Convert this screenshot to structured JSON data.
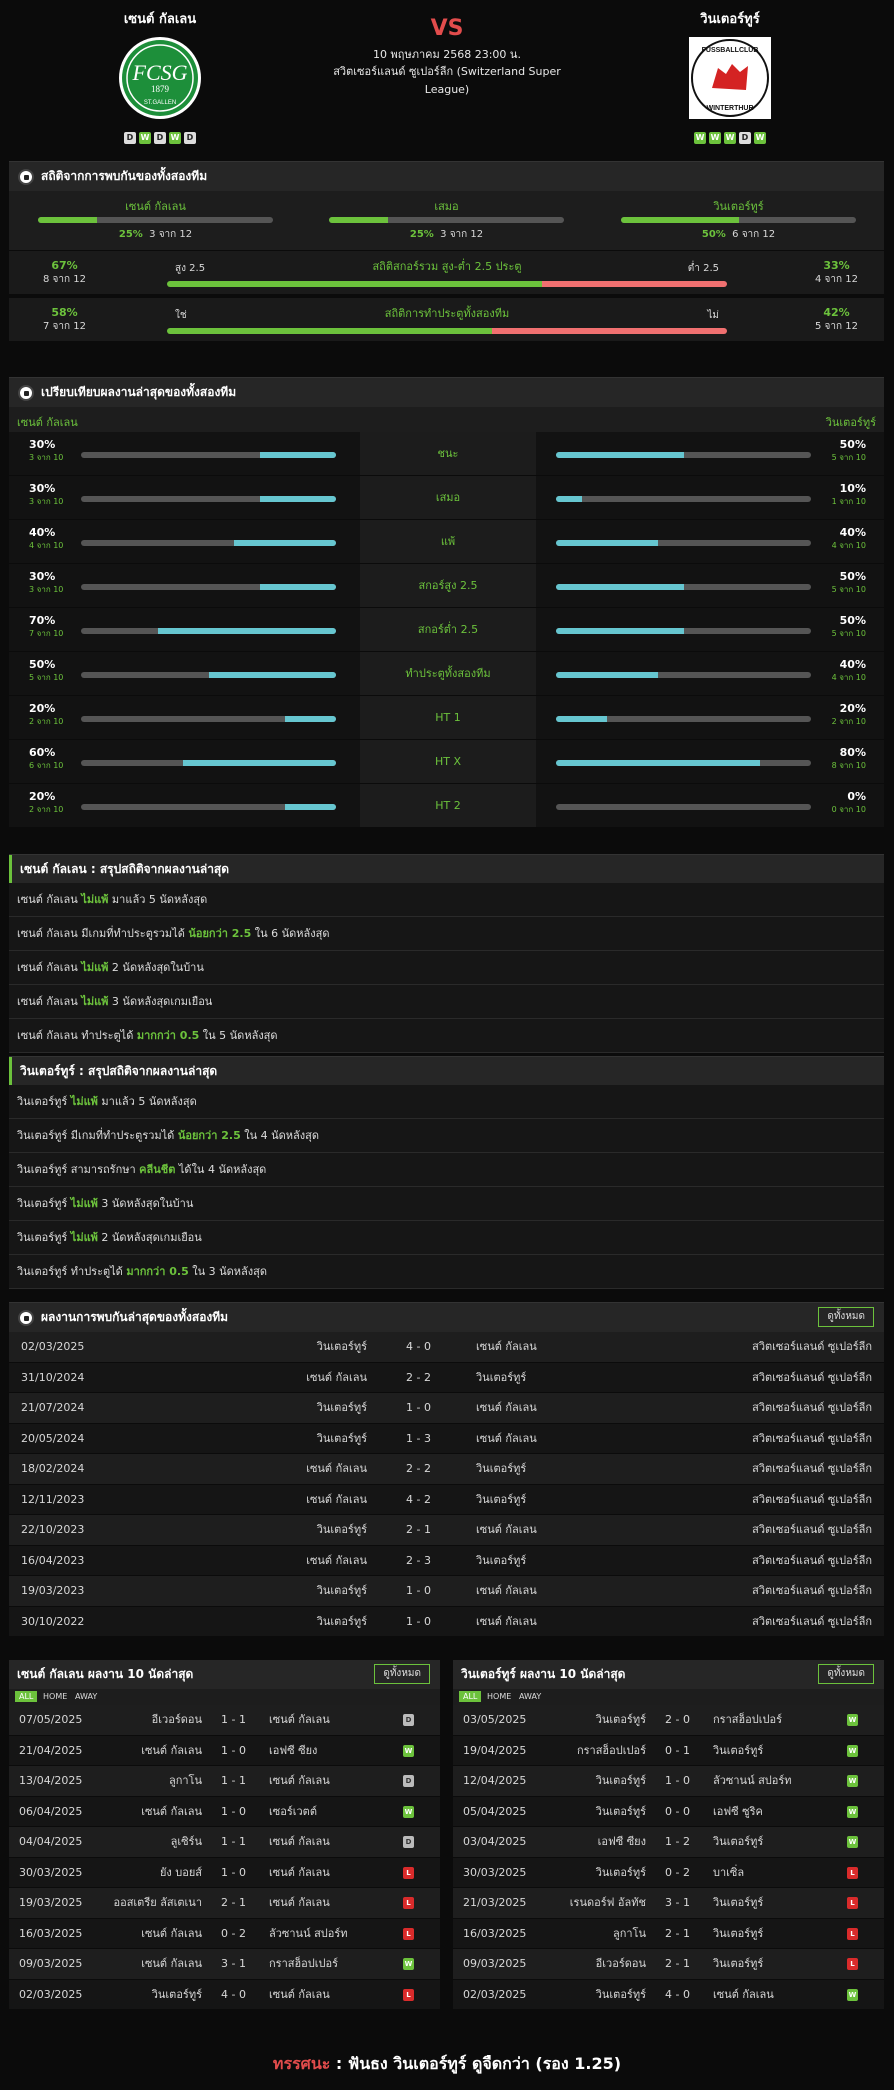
{
  "header": {
    "home_name": "เซนต์ กัลเลน",
    "away_name": "วินเตอร์ทูร์",
    "vs": "VS",
    "date": "10 พฤษภาคม 2568 23:00 น.",
    "league": "สวิตเซอร์แลนด์ ซูเปอร์ลีก (Switzerland Super League)",
    "home_form": [
      "D",
      "W",
      "D",
      "W",
      "D"
    ],
    "away_form": [
      "W",
      "W",
      "W",
      "D",
      "W"
    ],
    "home_logo_text": "FCSG",
    "home_logo_year": "1879",
    "home_logo_sub": "ST.GALLEN",
    "away_logo_top": "FUSSBALLCLUB",
    "away_logo_bottom": "WINTERTHUR"
  },
  "h2h_stats": {
    "title": "สถิติจากการพบกันของทั้งสองทีม",
    "cols": [
      {
        "label": "เซนต์ กัลเลน",
        "pct": "25%",
        "sub": "3 จาก 12",
        "fill": 0.25
      },
      {
        "label": "เสมอ",
        "pct": "25%",
        "sub": "3 จาก 12",
        "fill": 0.25
      },
      {
        "label": "วินเตอร์ทูร์",
        "pct": "50%",
        "sub": "6 จาก 12",
        "fill": 0.5
      }
    ],
    "ou": {
      "lpct": "67%",
      "lsub": "8 จาก 12",
      "ltext": "สูง 2.5",
      "title": "สถิติสกอร์รวม สูง-ต่ำ 2.5 ประตู",
      "rtext": "ต่ำ 2.5",
      "rpct": "33%",
      "rsub": "4 จาก 12",
      "fill": 0.67
    },
    "btts": {
      "lpct": "58%",
      "lsub": "7 จาก 12",
      "ltext": "ใช่",
      "title": "สถิติการทำประตูทั้งสองทีม",
      "rtext": "ไม่",
      "rpct": "42%",
      "rsub": "5 จาก 12",
      "fill": 0.58
    }
  },
  "compare": {
    "title": "เปรียบเทียบผลงานล่าสุดของทั้งสองทีม",
    "home": "เซนต์ กัลเลน",
    "away": "วินเตอร์ทูร์",
    "rows": [
      {
        "label": "ชนะ",
        "lp": "30%",
        "ls": "3 จาก 10",
        "lf": 0.3,
        "rp": "50%",
        "rs": "5 จาก 10",
        "rf": 0.5
      },
      {
        "label": "เสมอ",
        "lp": "30%",
        "ls": "3 จาก 10",
        "lf": 0.3,
        "rp": "10%",
        "rs": "1 จาก 10",
        "rf": 0.1
      },
      {
        "label": "แพ้",
        "lp": "40%",
        "ls": "4 จาก 10",
        "lf": 0.4,
        "rp": "40%",
        "rs": "4 จาก 10",
        "rf": 0.4
      },
      {
        "label": "สกอร์สูง 2.5",
        "lp": "30%",
        "ls": "3 จาก 10",
        "lf": 0.3,
        "rp": "50%",
        "rs": "5 จาก 10",
        "rf": 0.5
      },
      {
        "label": "สกอร์ต่ำ 2.5",
        "lp": "70%",
        "ls": "7 จาก 10",
        "lf": 0.7,
        "rp": "50%",
        "rs": "5 จาก 10",
        "rf": 0.5
      },
      {
        "label": "ทำประตูทั้งสองทีม",
        "lp": "50%",
        "ls": "5 จาก 10",
        "lf": 0.5,
        "rp": "40%",
        "rs": "4 จาก 10",
        "rf": 0.4
      },
      {
        "label": "HT 1",
        "lp": "20%",
        "ls": "2 จาก 10",
        "lf": 0.2,
        "rp": "20%",
        "rs": "2 จาก 10",
        "rf": 0.2
      },
      {
        "label": "HT X",
        "lp": "60%",
        "ls": "6 จาก 10",
        "lf": 0.6,
        "rp": "80%",
        "rs": "8 จาก 10",
        "rf": 0.8
      },
      {
        "label": "HT 2",
        "lp": "20%",
        "ls": "2 จาก 10",
        "lf": 0.2,
        "rp": "0%",
        "rs": "0 จาก 10",
        "rf": 0
      }
    ]
  },
  "home_summary": {
    "title": "เซนต์ กัลเลน : สรุปสถิติจากผลงานล่าสุด",
    "rows": [
      [
        "เซนต์ กัลเลน ",
        "ไม่แพ้",
        " มาแล้ว 5 นัดหลังสุด"
      ],
      [
        "เซนต์ กัลเลน มีเกมที่ทำประตูรวมได้ ",
        "น้อยกว่า 2.5",
        " ใน 6 นัดหลังสุด"
      ],
      [
        "เซนต์ กัลเลน ",
        "ไม่แพ้",
        " 2 นัดหลังสุดในบ้าน"
      ],
      [
        "เซนต์ กัลเลน ",
        "ไม่แพ้",
        " 3 นัดหลังสุดเกมเยือน"
      ],
      [
        "เซนต์ กัลเลน ทำประตูได้ ",
        "มากกว่า 0.5",
        " ใน 5 นัดหลังสุด"
      ]
    ]
  },
  "away_summary": {
    "title": "วินเตอร์ทูร์ : สรุปสถิติจากผลงานล่าสุด",
    "rows": [
      [
        "วินเตอร์ทูร์ ",
        "ไม่แพ้",
        " มาแล้ว 5 นัดหลังสุด"
      ],
      [
        "วินเตอร์ทูร์ มีเกมที่ทำประตูรวมได้ ",
        "น้อยกว่า 2.5",
        " ใน 4 นัดหลังสุด"
      ],
      [
        "วินเตอร์ทูร์ สามารถรักษา ",
        "คลีนชีต",
        " ได้ใน 4 นัดหลังสุด"
      ],
      [
        "วินเตอร์ทูร์ ",
        "ไม่แพ้",
        " 3 นัดหลังสุดในบ้าน"
      ],
      [
        "วินเตอร์ทูร์ ",
        "ไม่แพ้",
        " 2 นัดหลังสุดเกมเยือน"
      ],
      [
        "วินเตอร์ทูร์ ทำประตูได้ ",
        "มากกว่า 0.5",
        " ใน 3 นัดหลังสุด"
      ]
    ]
  },
  "h2h": {
    "title": "ผลงานการพบกันล่าสุดของทั้งสองทีม",
    "view_all": "ดูทั้งหมด",
    "rows": [
      [
        "02/03/2025",
        "วินเตอร์ทูร์",
        "4 - 0",
        "เซนต์ กัลเลน",
        "สวิตเซอร์แลนด์ ซูเปอร์ลีก"
      ],
      [
        "31/10/2024",
        "เซนต์ กัลเลน",
        "2 - 2",
        "วินเตอร์ทูร์",
        "สวิตเซอร์แลนด์ ซูเปอร์ลีก"
      ],
      [
        "21/07/2024",
        "วินเตอร์ทูร์",
        "1 - 0",
        "เซนต์ กัลเลน",
        "สวิตเซอร์แลนด์ ซูเปอร์ลีก"
      ],
      [
        "20/05/2024",
        "วินเตอร์ทูร์",
        "1 - 3",
        "เซนต์ กัลเลน",
        "สวิตเซอร์แลนด์ ซูเปอร์ลีก"
      ],
      [
        "18/02/2024",
        "เซนต์ กัลเลน",
        "2 - 2",
        "วินเตอร์ทูร์",
        "สวิตเซอร์แลนด์ ซูเปอร์ลีก"
      ],
      [
        "12/11/2023",
        "เซนต์ กัลเลน",
        "4 - 2",
        "วินเตอร์ทูร์",
        "สวิตเซอร์แลนด์ ซูเปอร์ลีก"
      ],
      [
        "22/10/2023",
        "วินเตอร์ทูร์",
        "2 - 1",
        "เซนต์ กัลเลน",
        "สวิตเซอร์แลนด์ ซูเปอร์ลีก"
      ],
      [
        "16/04/2023",
        "เซนต์ กัลเลน",
        "2 - 3",
        "วินเตอร์ทูร์",
        "สวิตเซอร์แลนด์ ซูเปอร์ลีก"
      ],
      [
        "19/03/2023",
        "วินเตอร์ทูร์",
        "1 - 0",
        "เซนต์ กัลเลน",
        "สวิตเซอร์แลนด์ ซูเปอร์ลีก"
      ],
      [
        "30/10/2022",
        "วินเตอร์ทูร์",
        "1 - 0",
        "เซนต์ กัลเลน",
        "สวิตเซอร์แลนด์ ซูเปอร์ลีก"
      ]
    ]
  },
  "home_last10": {
    "title": "เซนต์ กัลเลน ผลงาน 10 นัดล่าสุด",
    "view_all": "ดูทั้งหมด",
    "tabs": [
      "ALL",
      "HOME",
      "AWAY"
    ],
    "rows": [
      [
        "07/05/2025",
        "อีเวอร์ดอน",
        "1 - 1",
        "เซนต์ กัลเลน",
        "D"
      ],
      [
        "21/04/2025",
        "เซนต์ กัลเลน",
        "1 - 0",
        "เอฟซี ซียง",
        "W"
      ],
      [
        "13/04/2025",
        "ลูกาโน",
        "1 - 1",
        "เซนต์ กัลเลน",
        "D"
      ],
      [
        "06/04/2025",
        "เซนต์ กัลเลน",
        "1 - 0",
        "เซอร์เวตต์",
        "W"
      ],
      [
        "04/04/2025",
        "ลูเซิร์น",
        "1 - 1",
        "เซนต์ กัลเลน",
        "D"
      ],
      [
        "30/03/2025",
        "ยัง บอยส์",
        "1 - 0",
        "เซนต์ กัลเลน",
        "L"
      ],
      [
        "19/03/2025",
        "ออสเตรีย ลัสเตเนา",
        "2 - 1",
        "เซนต์ กัลเลน",
        "L"
      ],
      [
        "16/03/2025",
        "เซนต์ กัลเลน",
        "0 - 2",
        "ลัวซานน์ สปอร์ท",
        "L"
      ],
      [
        "09/03/2025",
        "เซนต์ กัลเลน",
        "3 - 1",
        "กราสฮ็อปเปอร์",
        "W"
      ],
      [
        "02/03/2025",
        "วินเตอร์ทูร์",
        "4 - 0",
        "เซนต์ กัลเลน",
        "L"
      ]
    ]
  },
  "away_last10": {
    "title": "วินเตอร์ทูร์ ผลงาน 10 นัดล่าสุด",
    "view_all": "ดูทั้งหมด",
    "tabs": [
      "ALL",
      "HOME",
      "AWAY"
    ],
    "rows": [
      [
        "03/05/2025",
        "วินเตอร์ทูร์",
        "2 - 0",
        "กราสฮ็อปเปอร์",
        "W"
      ],
      [
        "19/04/2025",
        "กราสฮ็อปเปอร์",
        "0 - 1",
        "วินเตอร์ทูร์",
        "W"
      ],
      [
        "12/04/2025",
        "วินเตอร์ทูร์",
        "1 - 0",
        "ลัวซานน์ สปอร์ท",
        "W"
      ],
      [
        "05/04/2025",
        "วินเตอร์ทูร์",
        "0 - 0",
        "เอฟซี ซูริค",
        "W"
      ],
      [
        "03/04/2025",
        "เอฟซี ซียง",
        "1 - 2",
        "วินเตอร์ทูร์",
        "W"
      ],
      [
        "30/03/2025",
        "วินเตอร์ทูร์",
        "0 - 2",
        "บาเซิ่ล",
        "L"
      ],
      [
        "21/03/2025",
        "เรนดอร์ฟ อัลทัช",
        "3 - 1",
        "วินเตอร์ทูร์",
        "L"
      ],
      [
        "16/03/2025",
        "ลูกาโน",
        "2 - 1",
        "วินเตอร์ทูร์",
        "L"
      ],
      [
        "09/03/2025",
        "อีเวอร์ดอน",
        "2 - 1",
        "วินเตอร์ทูร์",
        "L"
      ],
      [
        "02/03/2025",
        "วินเตอร์ทูร์",
        "4 - 0",
        "เซนต์ กัลเลน",
        "W"
      ]
    ]
  },
  "verdict": {
    "label": "ทรรศนะ",
    "colon": " : ",
    "text": "ฟันธง วินเตอร์ทูร์ ดูจืดกว่า (รอง 1.25)"
  }
}
